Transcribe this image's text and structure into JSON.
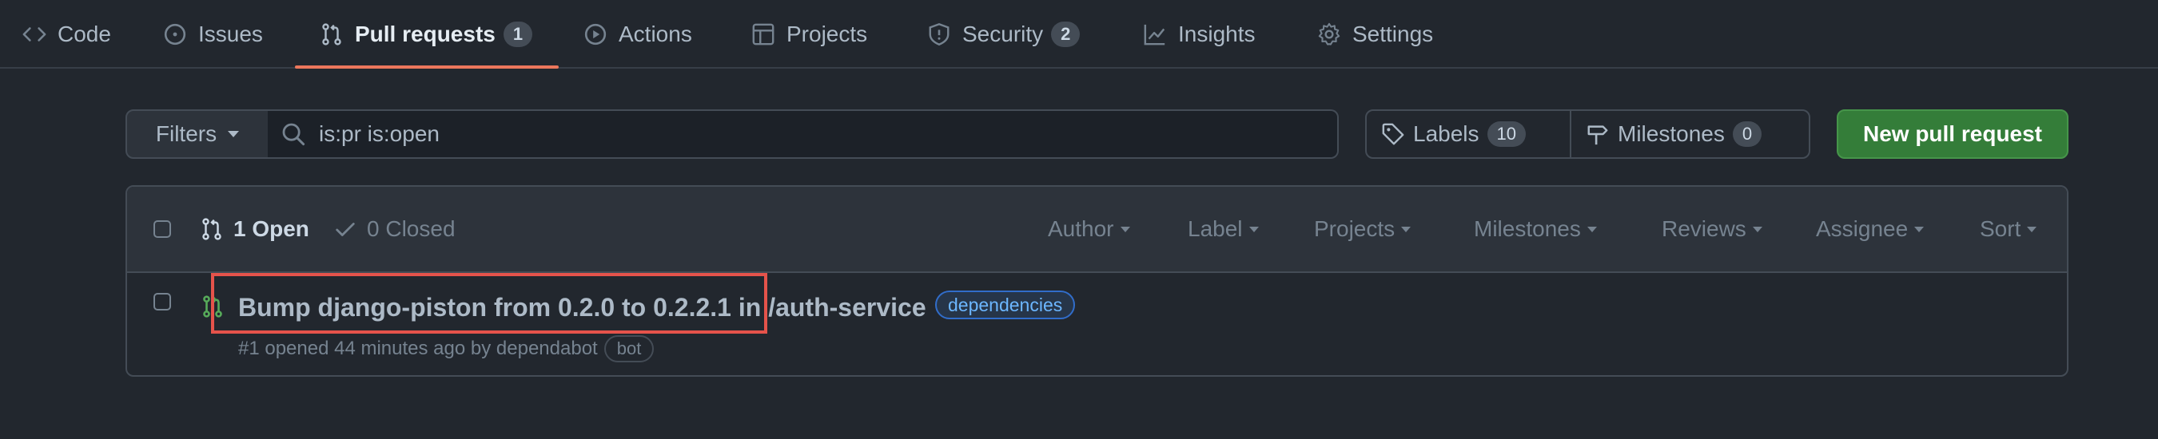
{
  "nav": {
    "tabs": [
      {
        "label": "Code",
        "icon": "code-icon"
      },
      {
        "label": "Issues",
        "icon": "issue-opened-icon"
      },
      {
        "label": "Pull requests",
        "icon": "git-pull-request-icon",
        "count": "1"
      },
      {
        "label": "Actions",
        "icon": "play-icon"
      },
      {
        "label": "Projects",
        "icon": "table-icon"
      },
      {
        "label": "Security",
        "icon": "shield-icon",
        "count": "2"
      },
      {
        "label": "Insights",
        "icon": "graph-icon"
      },
      {
        "label": "Settings",
        "icon": "gear-icon"
      }
    ],
    "accent_color": "#ec775c"
  },
  "toolbar": {
    "filters_label": "Filters",
    "search_value": "is:pr is:open",
    "labels_label": "Labels",
    "labels_count": "10",
    "milestones_label": "Milestones",
    "milestones_count": "0",
    "new_pr_label": "New pull request",
    "new_pr_color": "#347d39"
  },
  "list": {
    "open_label": "1 Open",
    "closed_label": "0 Closed",
    "filters": [
      "Author",
      "Label",
      "Projects",
      "Milestones",
      "Reviews",
      "Assignee",
      "Sort"
    ],
    "items": [
      {
        "title": "Bump django-piston from 0.2.0 to 0.2.2.1 in /auth-service",
        "label": "dependencies",
        "meta": "#1 opened 44 minutes ago by dependabot",
        "author_badge": "bot"
      }
    ]
  },
  "highlight_color": "#e5534b"
}
